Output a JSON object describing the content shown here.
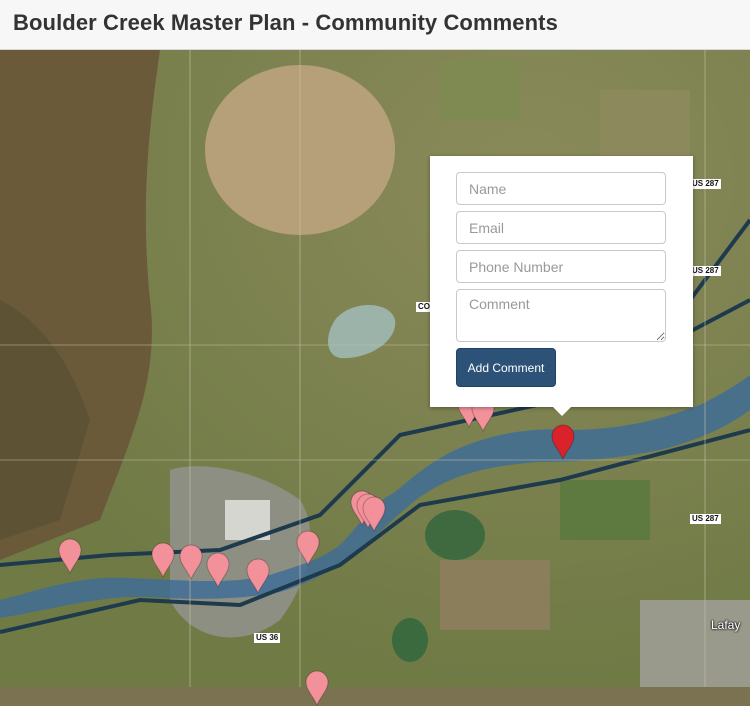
{
  "header": {
    "title": "Boulder Creek Master Plan - Community Comments"
  },
  "map": {
    "road_labels": [
      "US 287",
      "US 287",
      "US 287",
      "US 36",
      "CO"
    ],
    "place_labels": [
      "Lafay"
    ],
    "colors": {
      "river_buffer": "#3e6d99",
      "road_line": "#1e3a4d",
      "marker": "#f2919a",
      "marker_active": "#d9222a"
    }
  },
  "popup": {
    "name_placeholder": "Name",
    "email_placeholder": "Email",
    "phone_placeholder": "Phone Number",
    "comment_placeholder": "Comment",
    "submit_label": "Add Comment"
  }
}
